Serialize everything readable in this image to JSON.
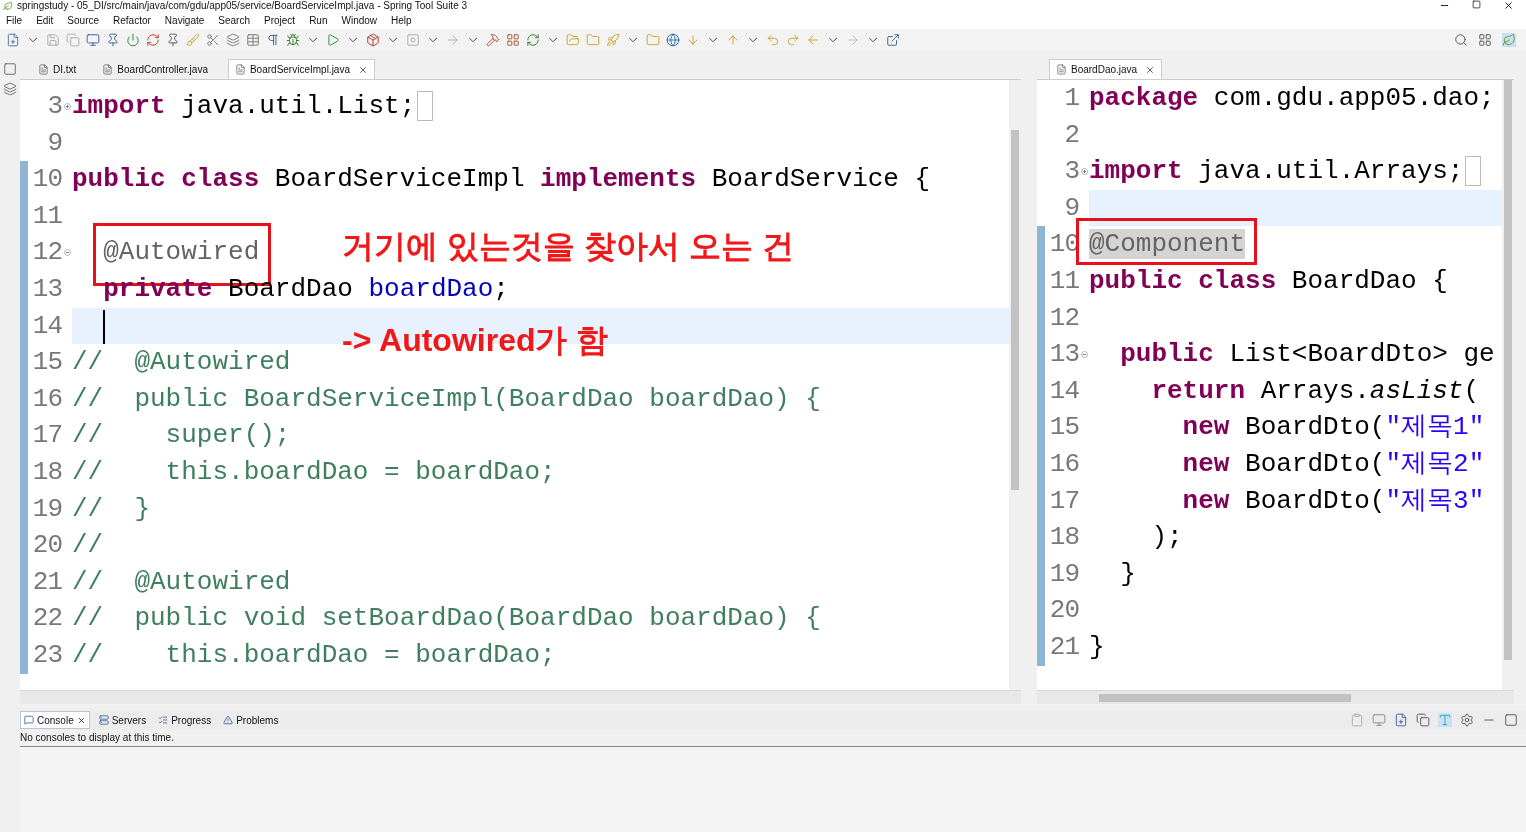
{
  "window": {
    "title": "springstudy - 05_DI/src/main/java/com/gdu/app05/service/BoardServiceImpl.java - Spring Tool Suite 3"
  },
  "menu": [
    "File",
    "Edit",
    "Source",
    "Refactor",
    "Navigate",
    "Search",
    "Project",
    "Run",
    "Window",
    "Help"
  ],
  "left_editor": {
    "tabs": [
      {
        "label": "DI.txt",
        "selected": false,
        "closable": false
      },
      {
        "label": "BoardController.java",
        "selected": false,
        "closable": false
      },
      {
        "label": "BoardServiceImpl.java",
        "selected": true,
        "closable": true
      }
    ],
    "lines": [
      {
        "number": "3",
        "fold": {
          "collapsed": true
        },
        "changed": false,
        "current": false,
        "tokens": [
          {
            "kind": "kw",
            "text": "import"
          },
          {
            "kind": "plain",
            "text": " java.util.List;"
          }
        ]
      },
      {
        "number": "9",
        "changed": false,
        "current": false
      },
      {
        "number": "10",
        "changed": true,
        "current": false,
        "tokens": [
          {
            "kind": "kw",
            "text": "public class"
          },
          {
            "kind": "plain",
            "text": " BoardServiceImpl "
          },
          {
            "kind": "kw",
            "text": "implements"
          },
          {
            "kind": "plain",
            "text": " BoardService {"
          }
        ]
      },
      {
        "number": "11",
        "changed": true,
        "current": false
      },
      {
        "number": "12",
        "fold": {
          "collapsed": false
        },
        "changed": true,
        "current": false,
        "tokens": [
          {
            "kind": "annotation",
            "text": "  @Autowired",
            "boxed": true
          }
        ]
      },
      {
        "number": "13",
        "changed": true,
        "current": false,
        "tokens": [
          {
            "kind": "kw",
            "text": "  private"
          },
          {
            "kind": "plain",
            "text": " BoardDao "
          },
          {
            "kind": "field",
            "text": "boardDao"
          },
          {
            "kind": "plain",
            "text": ";"
          }
        ]
      },
      {
        "number": "14",
        "changed": true,
        "current": true,
        "caret": true
      },
      {
        "number": "15",
        "changed": true,
        "current": false,
        "tokens": [
          {
            "kind": "comment",
            "text": "//  @Autowired"
          }
        ]
      },
      {
        "number": "16",
        "changed": true,
        "current": false,
        "tokens": [
          {
            "kind": "comment",
            "text": "//  public BoardServiceImpl(BoardDao boardDao) {"
          }
        ]
      },
      {
        "number": "17",
        "changed": true,
        "current": false,
        "tokens": [
          {
            "kind": "comment",
            "text": "//    super();"
          }
        ]
      },
      {
        "number": "18",
        "changed": true,
        "current": false,
        "tokens": [
          {
            "kind": "comment",
            "text": "//    this.boardDao = boardDao;"
          }
        ]
      },
      {
        "number": "19",
        "changed": true,
        "current": false,
        "tokens": [
          {
            "kind": "comment",
            "text": "//  }"
          }
        ]
      },
      {
        "number": "20",
        "changed": true,
        "current": false,
        "tokens": [
          {
            "kind": "comment",
            "text": "//"
          }
        ]
      },
      {
        "number": "21",
        "changed": true,
        "current": false,
        "tokens": [
          {
            "kind": "comment",
            "text": "//  @Autowired"
          }
        ]
      },
      {
        "number": "22",
        "changed": true,
        "current": false,
        "tokens": [
          {
            "kind": "comment",
            "text": "//  public void setBoardDao(BoardDao boardDao) {"
          }
        ]
      },
      {
        "number": "23",
        "changed": true,
        "current": false,
        "tokens": [
          {
            "kind": "comment",
            "text": "//    this.boardDao = boardDao;"
          }
        ]
      }
    ],
    "notes": [
      "거기에 있는것을 찾아서 오는 건",
      "-> Autowired가 함"
    ]
  },
  "right_editor": {
    "tabs": [
      {
        "label": "BoardDao.java",
        "selected": true,
        "closable": true
      }
    ],
    "lines": [
      {
        "number": "1",
        "changed": false,
        "current": false,
        "tokens": [
          {
            "kind": "kw",
            "text": "package"
          },
          {
            "kind": "plain",
            "text": " com.gdu.app05.dao;"
          }
        ]
      },
      {
        "number": "2",
        "changed": false,
        "current": false
      },
      {
        "number": "3",
        "fold": {
          "collapsed": true
        },
        "changed": false,
        "current": false,
        "tokens": [
          {
            "kind": "kw",
            "text": "import"
          },
          {
            "kind": "plain",
            "text": " java.util.Arrays;"
          }
        ]
      },
      {
        "number": "9",
        "changed": false,
        "current": true
      },
      {
        "number": "10",
        "changed": true,
        "current": false,
        "tokens": [
          {
            "kind": "annotation",
            "text": "@Component",
            "boxed": true,
            "marked": true
          }
        ]
      },
      {
        "number": "11",
        "changed": true,
        "current": false,
        "tokens": [
          {
            "kind": "kw",
            "text": "public class"
          },
          {
            "kind": "plain",
            "text": " BoardDao {"
          }
        ]
      },
      {
        "number": "12",
        "changed": true,
        "current": false
      },
      {
        "number": "13",
        "fold": {
          "collapsed": false
        },
        "changed": true,
        "current": false,
        "tokens": [
          {
            "kind": "kw",
            "text": "  public"
          },
          {
            "kind": "plain",
            "text": " List<BoardDto> ge"
          }
        ]
      },
      {
        "number": "14",
        "changed": true,
        "current": false,
        "tokens": [
          {
            "kind": "kw",
            "text": "    return"
          },
          {
            "kind": "plain",
            "text": " Arrays."
          },
          {
            "kind": "static",
            "text": "asList"
          },
          {
            "kind": "plain",
            "text": "("
          }
        ]
      },
      {
        "number": "15",
        "changed": true,
        "current": false,
        "tokens": [
          {
            "kind": "kw",
            "text": "      new"
          },
          {
            "kind": "plain",
            "text": " BoardDto("
          },
          {
            "kind": "string",
            "text": "\"제목1\""
          }
        ]
      },
      {
        "number": "16",
        "changed": true,
        "current": false,
        "tokens": [
          {
            "kind": "kw",
            "text": "      new"
          },
          {
            "kind": "plain",
            "text": " BoardDto("
          },
          {
            "kind": "string",
            "text": "\"제목2\""
          }
        ]
      },
      {
        "number": "17",
        "changed": true,
        "current": false,
        "tokens": [
          {
            "kind": "kw",
            "text": "      new"
          },
          {
            "kind": "plain",
            "text": " BoardDto("
          },
          {
            "kind": "string",
            "text": "\"제목3\""
          }
        ]
      },
      {
        "number": "18",
        "changed": true,
        "current": false,
        "tokens": [
          {
            "kind": "plain",
            "text": "    );"
          }
        ]
      },
      {
        "number": "19",
        "changed": true,
        "current": false,
        "tokens": [
          {
            "kind": "plain",
            "text": "  }"
          }
        ]
      },
      {
        "number": "20",
        "changed": true,
        "current": false
      },
      {
        "number": "21",
        "changed": true,
        "current": false,
        "tokens": [
          {
            "kind": "plain",
            "text": "}"
          }
        ]
      }
    ]
  },
  "bottom_panel": {
    "tabs": [
      {
        "label": "Console",
        "selected": true,
        "closable": true
      },
      {
        "label": "Servers",
        "selected": false,
        "closable": false
      },
      {
        "label": "Progress",
        "selected": false,
        "closable": false
      },
      {
        "label": "Problems",
        "selected": false,
        "closable": false
      }
    ],
    "message": "No consoles to display at this time."
  }
}
